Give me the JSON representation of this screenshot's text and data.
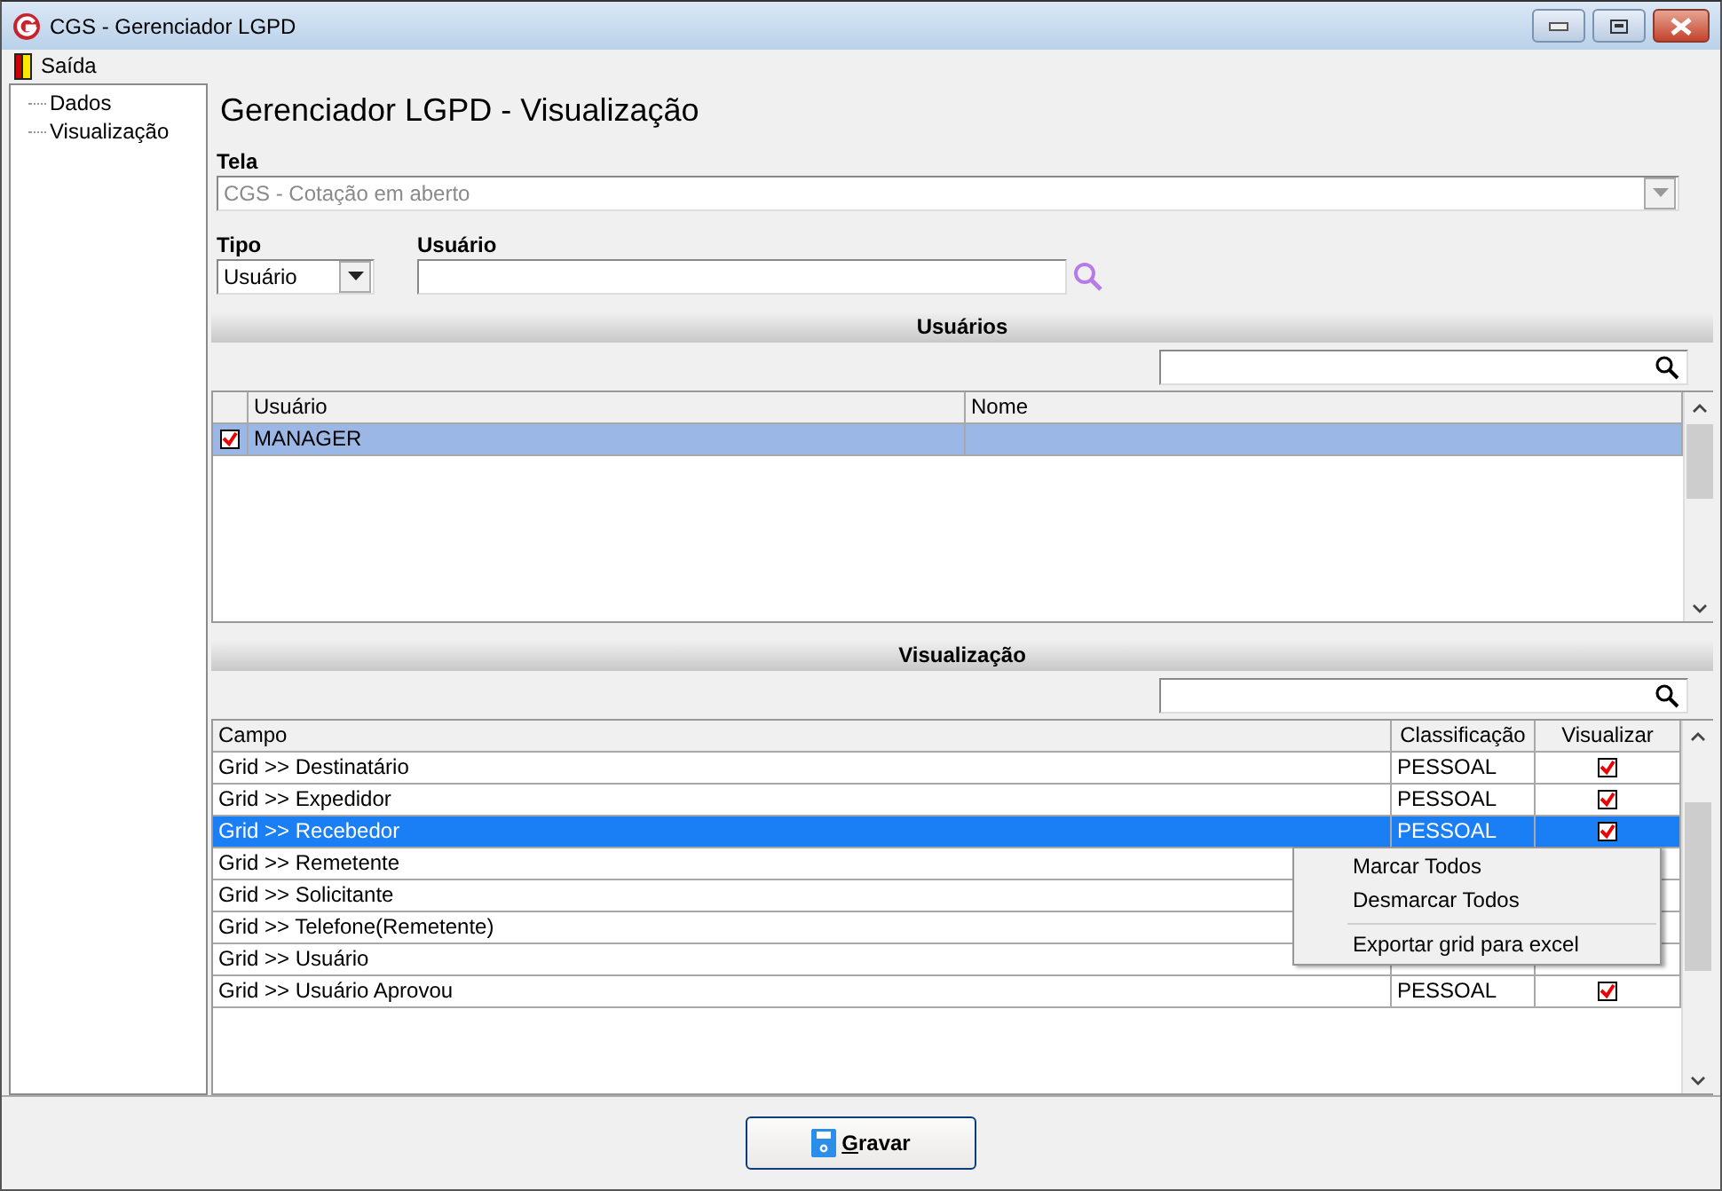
{
  "window": {
    "title": "CGS - Gerenciador LGPD"
  },
  "menu": [
    {
      "label": "Saída"
    }
  ],
  "tree": [
    {
      "label": "Dados"
    },
    {
      "label": "Visualização"
    }
  ],
  "heading": "Gerenciador LGPD - Visualização",
  "tela": {
    "label": "Tela",
    "value": "CGS - Cotação em aberto",
    "disabled": true
  },
  "tipo": {
    "label": "Tipo",
    "value": "Usuário"
  },
  "usuario": {
    "label": "Usuário"
  },
  "usuarios": {
    "title": "Usuários",
    "columns": [
      "Usuário",
      "Nome"
    ],
    "rows": [
      {
        "usuario": "MANAGER",
        "checked": true,
        "selected": true
      }
    ]
  },
  "visualizacao": {
    "title": "Visualização",
    "columns": [
      "Campo",
      "Classificação",
      "Visualizar"
    ],
    "rows": [
      {
        "campo": "Grid >> Destinatário",
        "classificacao": "PESSOAL",
        "visualizar": true,
        "selected": false
      },
      {
        "campo": "Grid >> Expedidor",
        "classificacao": "PESSOAL",
        "visualizar": true,
        "selected": false
      },
      {
        "campo": "Grid >> Recebedor",
        "classificacao": "PESSOAL",
        "visualizar": true,
        "selected": true
      },
      {
        "campo": "Grid >> Remetente",
        "selected": false
      },
      {
        "campo": "Grid >> Solicitante",
        "selected": false
      },
      {
        "campo": "Grid >> Telefone(Remetente)",
        "selected": false
      },
      {
        "campo": "Grid >> Usuário",
        "selected": false
      },
      {
        "campo": "Grid >> Usuário Aprovou",
        "classificacao": "PESSOAL",
        "visualizar": true,
        "selected": false
      }
    ]
  },
  "context_menu": [
    {
      "kind": "item",
      "label": "Marcar Todos"
    },
    {
      "kind": "item",
      "label": "Desmarcar Todos"
    },
    {
      "kind": "separator"
    },
    {
      "kind": "item",
      "label": "Exportar grid para excel"
    }
  ],
  "save_button": {
    "label": "Gravar"
  }
}
